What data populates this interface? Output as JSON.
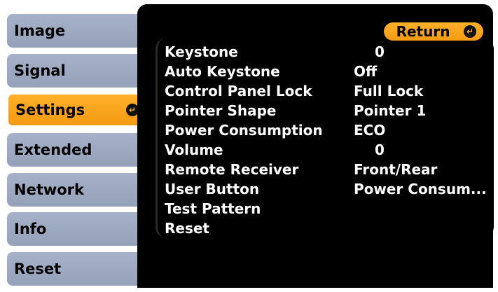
{
  "sidebar": {
    "tabs": [
      {
        "label": "Image",
        "active": false
      },
      {
        "label": "Signal",
        "active": false
      },
      {
        "label": "Settings",
        "active": true
      },
      {
        "label": "Extended",
        "active": false
      },
      {
        "label": "Network",
        "active": false
      },
      {
        "label": "Info",
        "active": false
      },
      {
        "label": "Reset",
        "active": false
      }
    ]
  },
  "main": {
    "return_label": "Return",
    "items": [
      {
        "label": "Keystone",
        "value": "0"
      },
      {
        "label": "Auto Keystone",
        "value": "Off"
      },
      {
        "label": "Control Panel Lock",
        "value": "Full Lock"
      },
      {
        "label": "Pointer Shape",
        "value": "Pointer 1"
      },
      {
        "label": "Power Consumption",
        "value": "ECO"
      },
      {
        "label": "Volume",
        "value": "0"
      },
      {
        "label": "Remote Receiver",
        "value": "Front/Rear"
      },
      {
        "label": "User Button",
        "value": "Power Consum..."
      },
      {
        "label": "Test Pattern",
        "value": ""
      },
      {
        "label": "Reset",
        "value": ""
      }
    ]
  },
  "colors": {
    "accent": "#f6a21b",
    "tab_bg": "#9ea9c2",
    "panel_bg": "#000000",
    "text_light": "#ffffff"
  },
  "icons": {
    "enter": "enter-icon"
  }
}
